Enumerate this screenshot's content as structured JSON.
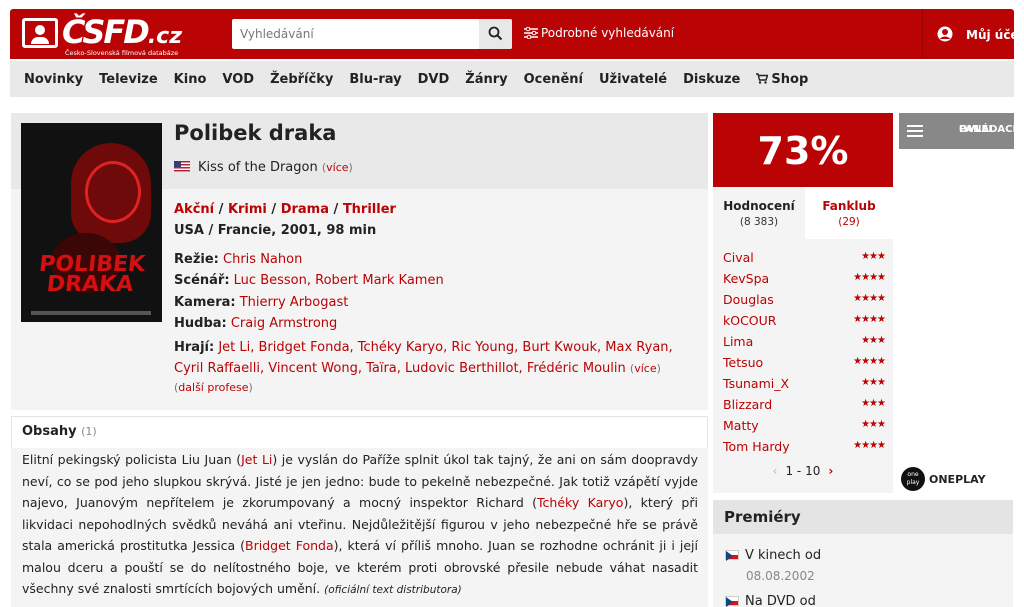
{
  "header": {
    "logo_text": "ČSFD",
    "logo_suffix": ".cz",
    "logo_tagline": "Česko-Slovenská filmová databáze",
    "search_placeholder": "Vyhledávání",
    "advanced_search": "Podrobné vyhledávání",
    "account": "Můj účet"
  },
  "menu": [
    "Novinky",
    "Televize",
    "Kino",
    "VOD",
    "Žebříčky",
    "Blu-ray",
    "DVD",
    "Žánry",
    "Ocenění",
    "Uživatelé",
    "Diskuze",
    "Shop"
  ],
  "film": {
    "title": "Polibek draka",
    "original_title": "Kiss of the Dragon",
    "more": "více",
    "poster_title": "POLIBEK DRAKA",
    "genres": [
      "Akční",
      "Krimi",
      "Drama",
      "Thriller"
    ],
    "origin": "USA / Francie, 2001, 98 min",
    "credits": [
      {
        "label": "Režie:",
        "names": "Chris Nahon"
      },
      {
        "label": "Scénář:",
        "names": "Luc Besson, Robert Mark Kamen"
      },
      {
        "label": "Kamera:",
        "names": "Thierry Arbogast"
      },
      {
        "label": "Hudba:",
        "names": "Craig Armstrong"
      }
    ],
    "cast_label": "Hrají:",
    "cast": "Jet Li, Bridget Fonda, Tchéky Karyo, Ric Young, Burt Kwouk, Max Ryan, Cyril Raffaelli, Vincent Wong, Taïra, Ludovic Berthillot, Frédéric Moulin",
    "cast_more": "více",
    "other_professions": "další profese"
  },
  "plot": {
    "title": "Obsahy",
    "count": "(1)",
    "p1": "Elitní pekingský policista Liu Juan (",
    "l1": "Jet Li",
    "p2": ") je vyslán do Paříže splnit úkol tak tajný, že ani on sám doopravdy neví, co se pod jeho slupkou skrývá. Jisté je jen jedno: bude to pekelně nebezpečné. Jak totiž vzápětí vyjde najevo, Juanovým nepřítelem je zkorumpovaný a mocný inspektor Richard (",
    "l2": "Tchéky Karyo",
    "p3": "), který při likvidaci nepohodlných svědků neváhá ani vteřinu. Nejdůležitější figurou v jeho nebezpečné hře se právě stala americká prostitutka Jessica (",
    "l3": "Bridget Fonda",
    "p4": "), která ví příliš mnoho. Juan se rozhodne ochránit ji i její malou dceru a pouští se do nelítostného boje, ve kterém proti obrovské přesile nebude váhat nasadit všechny své znalosti smrtících bojových umění.",
    "source": "(oficiální text distributora)"
  },
  "rating": {
    "score": "73%",
    "tab_ratings": "Hodnocení",
    "tab_ratings_count": "(8 383)",
    "tab_fanclub": "Fanklub",
    "tab_fanclub_count": "(29)",
    "users": [
      {
        "name": "Cival",
        "stars": 3
      },
      {
        "name": "KevSpa",
        "stars": 4
      },
      {
        "name": "Douglas",
        "stars": 4
      },
      {
        "name": "kOCOUR",
        "stars": 4
      },
      {
        "name": "Lima",
        "stars": 3
      },
      {
        "name": "Tetsuo",
        "stars": 4
      },
      {
        "name": "Tsunami_X",
        "stars": 3
      },
      {
        "name": "Blizzard",
        "stars": 3
      },
      {
        "name": "Matty",
        "stars": 3
      },
      {
        "name": "Tom Hardy",
        "stars": 4
      }
    ],
    "pager": "1 - 10"
  },
  "premieres": {
    "title": "Premiéry",
    "cinema_label": "V kinech od",
    "cinema_date": "08.08.2002",
    "dvd_label": "Na DVD od"
  },
  "side": {
    "control_panel_line1": "OVLÁDACÍ",
    "control_panel_line2": "PANEL",
    "oneplay_logo": "one play",
    "oneplay": "ONEPLAY"
  },
  "colors": {
    "brand": "#ba0305",
    "panel": "#f4f4f4",
    "header_gray": "#e9e9e9"
  }
}
